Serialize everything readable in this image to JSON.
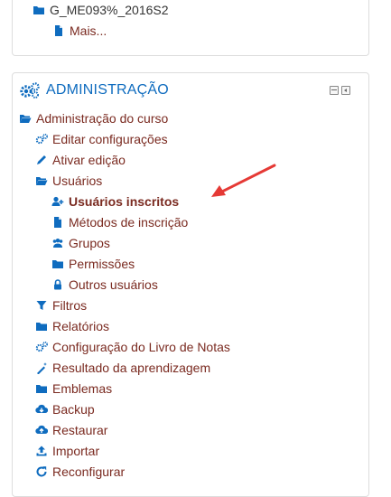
{
  "top_block": {
    "course_item": "G_ME093%_2016S2",
    "more_item": "Mais..."
  },
  "admin_block": {
    "title": "ADMINISTRAÇÃO",
    "course_admin": "Administração do curso",
    "items": {
      "edit_settings": "Editar configurações",
      "turn_editing_on": "Ativar edição",
      "users": "Usuários",
      "enrolled_users": "Usuários inscritos",
      "enrolment_methods": "Métodos de inscrição",
      "groups": "Grupos",
      "permissions": "Permissões",
      "other_users": "Outros usuários",
      "filters": "Filtros",
      "reports": "Relatórios",
      "gradebook_setup": "Configuração do Livro de Notas",
      "outcomes": "Resultado da aprendizagem",
      "badges": "Emblemas",
      "backup": "Backup",
      "restore": "Restaurar",
      "import": "Importar",
      "reset": "Reconfigurar"
    }
  },
  "colors": {
    "link": "#7a2a20",
    "heading": "#0f6cbf",
    "icon": "#0f6cbf",
    "arrow": "#e53935"
  }
}
